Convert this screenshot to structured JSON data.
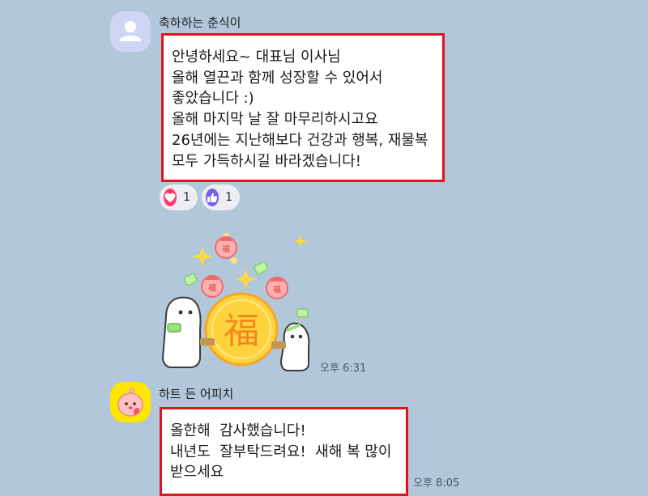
{
  "messages": [
    {
      "sender": "축하하는 춘식이",
      "lines": [
        "안녕하세요~ 대표님 이사님",
        "올해 열끈과 함께 성장할 수 있어서",
        "좋았습니다 :)",
        "올해 마지막 날 잘 마무리하시고요",
        "26년에는 지난해보다 건강과 행복, 재물복",
        "모두 가득하시길 바라겠습니다!"
      ],
      "reactions": [
        {
          "icon": "heart-icon",
          "count": "1",
          "color": "#ff3b6a"
        },
        {
          "icon": "thumbs-up-icon",
          "count": "1",
          "color": "#7b5cf0"
        }
      ]
    },
    {
      "sticker": {
        "character": "福"
      },
      "time": "오후 6:31"
    },
    {
      "sender": "하트 든 어피치",
      "lines": [
        "올한해  감사했습니다!",
        "내년도  잘부탁드려요!  새해 복 많이",
        "받으세요"
      ],
      "time": "오후 8:05"
    }
  ],
  "colors": {
    "background": "#b2c7da",
    "highlight_border": "#e3141e",
    "bubble": "#ffffff",
    "avatar_default": "#cfd6f4",
    "avatar_apeach": "#ffe600"
  }
}
